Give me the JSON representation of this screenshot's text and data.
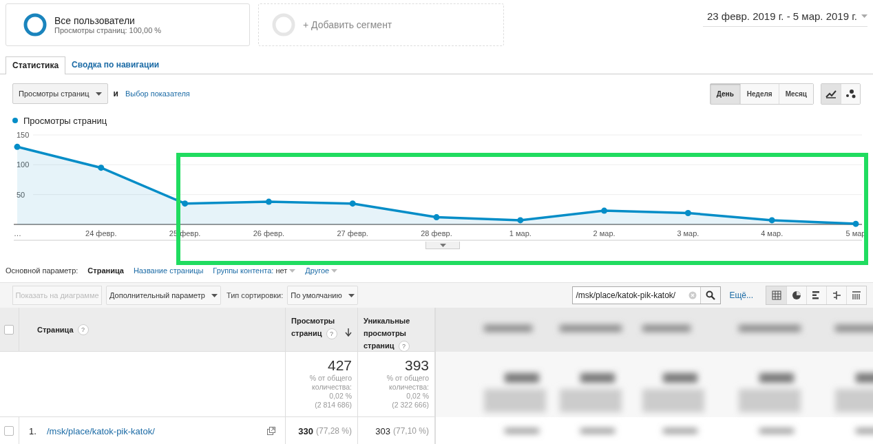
{
  "segments": [
    {
      "kind": "active",
      "title": "Все пользователи",
      "subtitle": "Просмотры страниц: 100,00 %"
    },
    {
      "kind": "add",
      "title": "+ Добавить сегмент"
    }
  ],
  "date_range": "23 февр. 2019 г. - 5 мар. 2019 г.",
  "tabs": [
    {
      "label": "Статистика",
      "selected": true
    },
    {
      "label": "Сводка по навигации",
      "selected": false
    }
  ],
  "metric_select": "Просмотры страниц",
  "conjunction": "и",
  "metric_link": "Выбор показателя",
  "periods": [
    {
      "label": "День",
      "selected": true
    },
    {
      "label": "Неделя",
      "selected": false
    },
    {
      "label": "Месяц",
      "selected": false
    }
  ],
  "chart_types": [
    {
      "kind": "line",
      "selected": true
    },
    {
      "kind": "scatter",
      "selected": false
    }
  ],
  "chart_data": {
    "type": "area",
    "categories": [
      "…",
      "24 февр.",
      "25 февр.",
      "26 февр.",
      "27 февр.",
      "28 февр.",
      "1 мар.",
      "2 мар.",
      "3 мар.",
      "4 мар.",
      "5 мар"
    ],
    "series": [
      {
        "name": "Просмотры страниц",
        "color": "#058dc7",
        "values": [
          130,
          95,
          35,
          38,
          35,
          12,
          7,
          23,
          19,
          7,
          1
        ]
      }
    ],
    "ylim": [
      0,
      150
    ],
    "yticks": [
      50,
      100,
      150
    ]
  },
  "dimension": {
    "label": "Основной параметр:",
    "options": [
      {
        "label": "Страница",
        "selected": true
      },
      {
        "label": "Название страницы",
        "selected": false
      }
    ],
    "menus": [
      {
        "label": "Группы контента:",
        "value": "нет"
      },
      {
        "label": "Другое"
      }
    ]
  },
  "toolbar": {
    "plot_button": {
      "label": "Показать на диаграмме",
      "disabled": true
    },
    "secondary": "Дополнительный параметр",
    "sort_label": "Тип сортировки:",
    "sort_value": "По умолчанию",
    "search_value": "/msk/place/katok-pik-katok/",
    "more_link": "Ещё...",
    "views": [
      {
        "kind": "table",
        "selected": true
      },
      {
        "kind": "pie",
        "selected": false
      },
      {
        "kind": "bars",
        "selected": false
      },
      {
        "kind": "compare",
        "selected": false
      },
      {
        "kind": "pivot",
        "selected": false
      }
    ]
  },
  "table": {
    "all_checked": false,
    "columns": [
      {
        "label": "Страница",
        "help": "?",
        "sorted": false
      },
      {
        "label": "Просмотры страниц",
        "help": "?",
        "sorted": true
      },
      {
        "label": "Уникальные просмотры страниц",
        "help": "?",
        "sorted": false
      }
    ],
    "totals": [
      {
        "value": "427",
        "note": [
          "% от общего",
          "количества:",
          "0,02 %",
          "(2 814 686)"
        ]
      },
      {
        "value": "393",
        "note": [
          "% от общего",
          "количества:",
          "0,02 %",
          "(2 322 666)"
        ]
      }
    ],
    "rows": [
      {
        "checked": false,
        "index": "1.",
        "page": "/msk/place/katok-pik-katok/",
        "views": "330",
        "views_share": "(77,28 %)",
        "unique": "303",
        "unique_share": "(77,10 %)"
      }
    ]
  }
}
